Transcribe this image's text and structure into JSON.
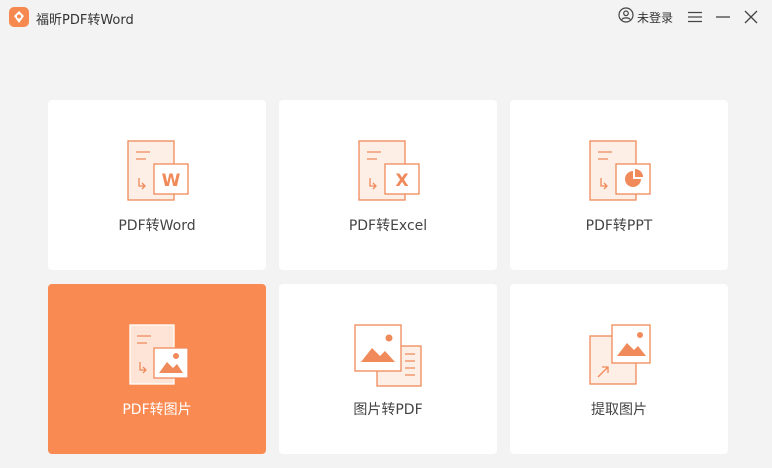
{
  "app": {
    "title": "福昕PDF转Word"
  },
  "header": {
    "login_label": "未登录"
  },
  "cards": [
    {
      "label": "PDF转Word"
    },
    {
      "label": "PDF转Excel"
    },
    {
      "label": "PDF转PPT"
    },
    {
      "label": "PDF转图片"
    },
    {
      "label": "图片转PDF"
    },
    {
      "label": "提取图片"
    }
  ],
  "colors": {
    "accent": "#f98a52",
    "background": "#f3f3f3",
    "card": "#ffffff",
    "icon_stroke": "#f08a5a"
  },
  "active_card": "PDF转图片"
}
